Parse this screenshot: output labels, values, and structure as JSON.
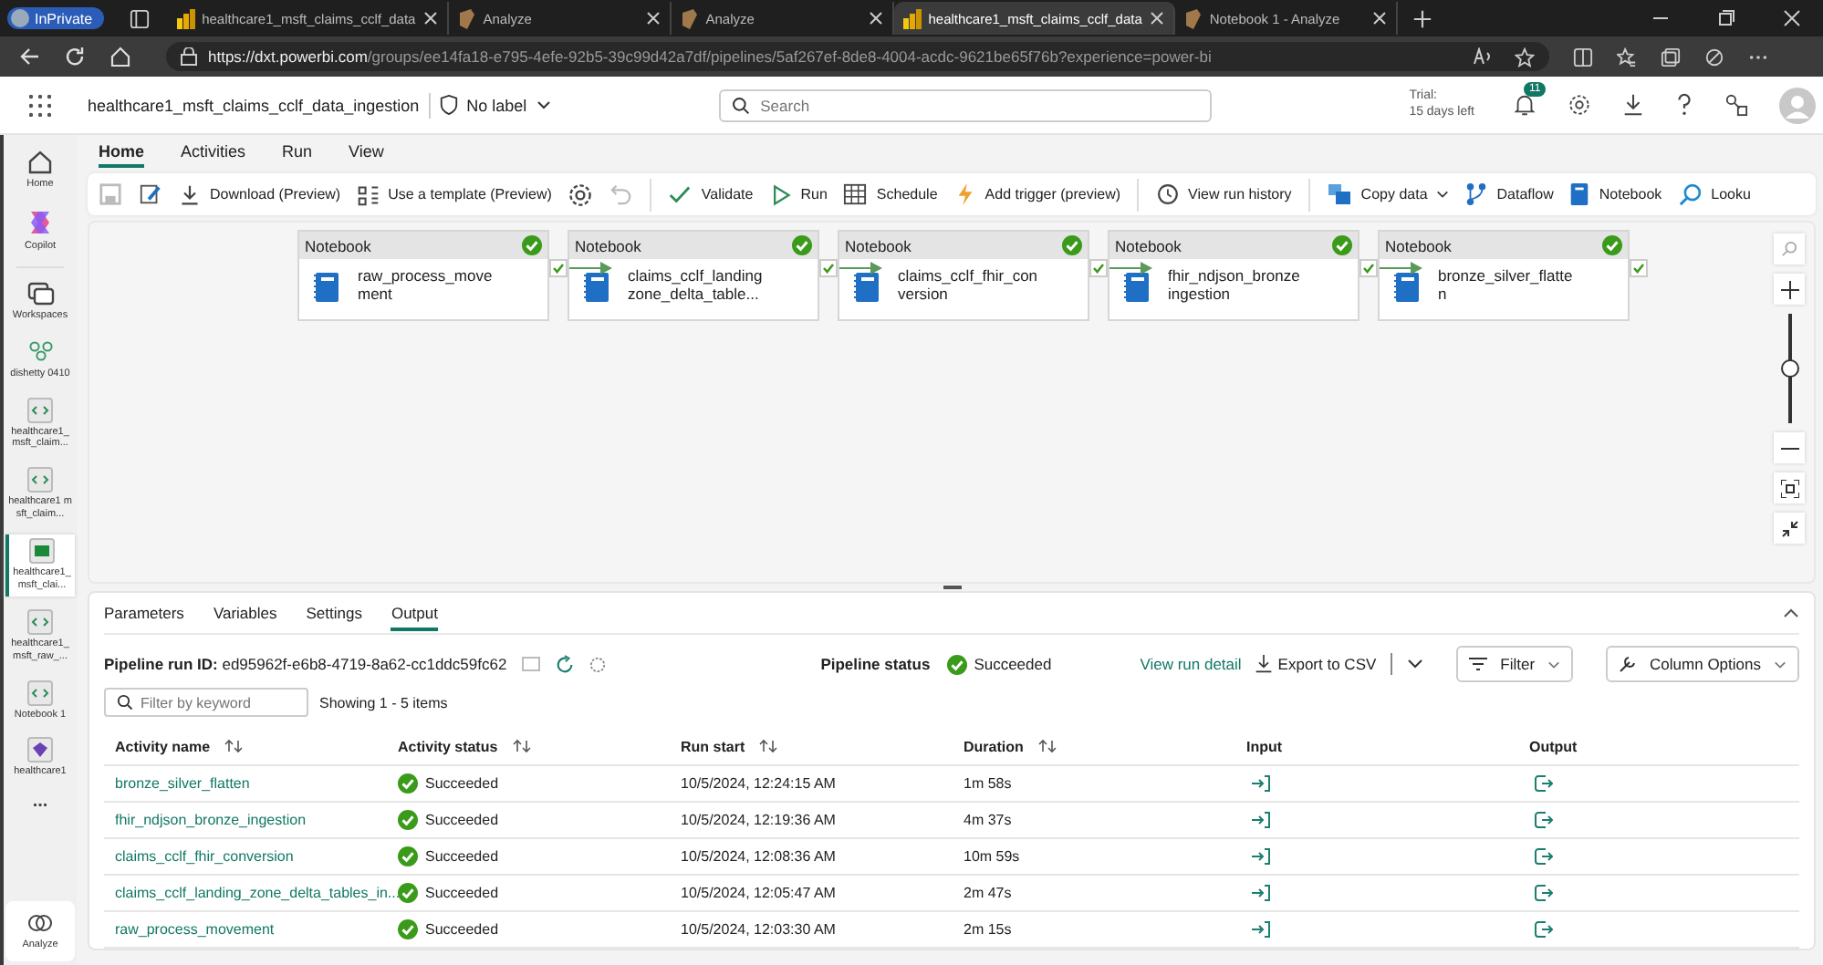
{
  "browser": {
    "profile": "InPrivate",
    "tabs": [
      {
        "title": "healthcare1_msft_claims_cclf_data",
        "kind": "powerbi",
        "selected": false
      },
      {
        "title": "Analyze",
        "kind": "fabric",
        "selected": false
      },
      {
        "title": "Analyze",
        "kind": "fabric",
        "selected": false
      },
      {
        "title": "healthcare1_msft_claims_cclf_data",
        "kind": "powerbi",
        "selected": true
      },
      {
        "title": "Notebook 1 - Analyze",
        "kind": "fabric",
        "selected": false
      }
    ],
    "url_host": "https://dxt.powerbi.com",
    "url_path": "/groups/ee14fa18-e795-4efe-92b5-39c99d42a7df/pipelines/5af267ef-8de8-4004-acdc-9621be65f76b?experience=power-bi"
  },
  "app_header": {
    "title": "healthcare1_msft_claims_cclf_data_ingestion",
    "sensitivity": "No label",
    "search": {
      "placeholder": "Search"
    },
    "trial_label": "Trial:",
    "trial_days": "15 days left",
    "notifications": "11"
  },
  "rail": [
    {
      "kind": "home",
      "label": "Home",
      "selected": false
    },
    {
      "kind": "copilot",
      "label": "Copilot",
      "selected": false
    },
    {
      "kind": "workspaces",
      "label": "Workspaces",
      "selected": false
    },
    {
      "kind": "workspace",
      "label": "dishetty 0410",
      "selected": false
    },
    {
      "kind": "notebook",
      "label": "healthcare1_ msft_claim...",
      "selected": false
    },
    {
      "kind": "notebook",
      "label": "healthcare1 msft_claim...",
      "selected": false
    },
    {
      "kind": "pipeline",
      "label": "healthcare1_ msft_clai...",
      "selected": true
    },
    {
      "kind": "notebook",
      "label": "healthcare1_ msft_raw_...",
      "selected": false
    },
    {
      "kind": "notebook",
      "label": "Notebook 1",
      "selected": false
    },
    {
      "kind": "lakehouse",
      "label": "healthcare1",
      "selected": false
    },
    {
      "kind": "more",
      "label": "...",
      "selected": false
    }
  ],
  "rail_bottom": {
    "label": "Analyze"
  },
  "ribbon": {
    "tabs": [
      {
        "label": "Home",
        "selected": true
      },
      {
        "label": "Activities",
        "selected": false
      },
      {
        "label": "Run",
        "selected": false
      },
      {
        "label": "View",
        "selected": false
      }
    ],
    "toolbar": [
      {
        "kind": "save",
        "disabled": true
      },
      {
        "kind": "edit",
        "disabled": false
      },
      {
        "kind": "download",
        "label": "Download (Preview)",
        "disabled": false
      },
      {
        "kind": "template",
        "label": "Use a template (Preview)",
        "disabled": false
      },
      {
        "kind": "settings",
        "disabled": false
      },
      {
        "kind": "undo",
        "disabled": true
      },
      {
        "kind": "separator"
      },
      {
        "kind": "validate",
        "label": "Validate",
        "disabled": false
      },
      {
        "kind": "run",
        "label": "Run",
        "disabled": false
      },
      {
        "kind": "schedule",
        "label": "Schedule",
        "disabled": false
      },
      {
        "kind": "trigger",
        "label": "Add trigger (preview)",
        "disabled": false
      },
      {
        "kind": "separator"
      },
      {
        "kind": "history",
        "label": "View run history",
        "disabled": false
      },
      {
        "kind": "separator"
      },
      {
        "kind": "copy",
        "label": "Copy data",
        "disabled": false
      },
      {
        "kind": "dataflow",
        "label": "Dataflow",
        "disabled": false
      },
      {
        "kind": "notebook",
        "label": "Notebook",
        "disabled": false
      },
      {
        "kind": "lookup",
        "label": "Looku",
        "disabled": false
      }
    ]
  },
  "pipeline": {
    "nodes": [
      {
        "type": "Notebook",
        "name_lines": [
          "raw_process_move",
          "ment"
        ],
        "succeeded": true
      },
      {
        "type": "Notebook",
        "name_lines": [
          "claims_cclf_landing",
          "zone_delta_table..."
        ],
        "succeeded": true
      },
      {
        "type": "Notebook",
        "name_lines": [
          "claims_cclf_fhir_con",
          "version"
        ],
        "succeeded": true
      },
      {
        "type": "Notebook",
        "name_lines": [
          "fhir_ndjson_bronze",
          "ingestion"
        ],
        "succeeded": true
      },
      {
        "type": "Notebook",
        "name_lines": [
          "bronze_silver_flatte",
          "n"
        ],
        "succeeded": true
      }
    ],
    "zoom": {
      "level": 0.5
    }
  },
  "output_panel": {
    "tabs": [
      {
        "label": "Parameters",
        "selected": false
      },
      {
        "label": "Variables",
        "selected": false
      },
      {
        "label": "Settings",
        "selected": false
      },
      {
        "label": "Output",
        "selected": true
      }
    ],
    "run_id_label": "Pipeline run ID:",
    "run_id": "ed95962f-e6b8-4719-8a62-cc1ddc59fc62",
    "status_label": "Pipeline status",
    "status": "Succeeded",
    "status_ok": true,
    "view_detail": "View run detail",
    "export": "Export to CSV",
    "filter": "Filter",
    "column_options": "Column Options",
    "search": {
      "placeholder": "Filter by keyword"
    },
    "showing": "Showing 1 - 5 items",
    "columns": [
      {
        "label": "Activity name",
        "sortable": true
      },
      {
        "label": "Activity status",
        "sortable": true
      },
      {
        "label": "Run start",
        "sortable": true
      },
      {
        "label": "Duration",
        "sortable": true
      },
      {
        "label": "Input",
        "sortable": false
      },
      {
        "label": "Output",
        "sortable": false
      }
    ],
    "rows": [
      {
        "name": "bronze_silver_flatten",
        "status": "Succeeded",
        "succeeded": true,
        "run_start": "10/5/2024, 12:24:15 AM",
        "duration": "1m 58s"
      },
      {
        "name": "fhir_ndjson_bronze_ingestion",
        "status": "Succeeded",
        "succeeded": true,
        "run_start": "10/5/2024, 12:19:36 AM",
        "duration": "4m 37s"
      },
      {
        "name": "claims_cclf_fhir_conversion",
        "status": "Succeeded",
        "succeeded": true,
        "run_start": "10/5/2024, 12:08:36 AM",
        "duration": "10m 59s"
      },
      {
        "name": "claims_cclf_landing_zone_delta_tables_in...",
        "status": "Succeeded",
        "succeeded": true,
        "run_start": "10/5/2024, 12:05:47 AM",
        "duration": "2m 47s"
      },
      {
        "name": "raw_process_movement",
        "status": "Succeeded",
        "succeeded": true,
        "run_start": "10/5/2024, 12:03:30 AM",
        "duration": "2m 15s"
      }
    ]
  }
}
